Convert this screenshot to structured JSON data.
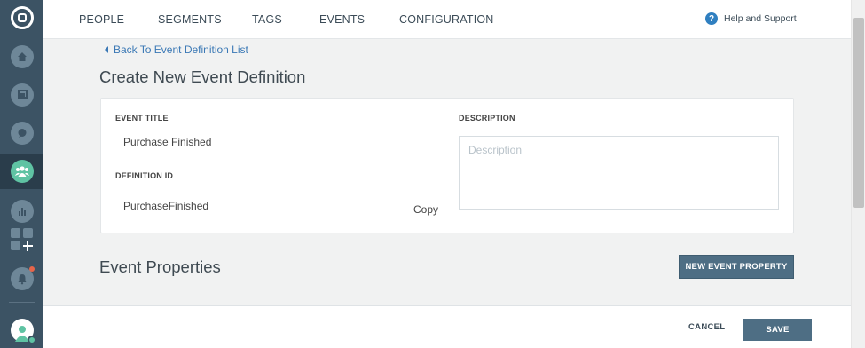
{
  "nav": {
    "items": [
      "PEOPLE",
      "SEGMENTS",
      "TAGS",
      "EVENTS",
      "CONFIGURATION"
    ],
    "help_label": "Help and Support",
    "help_glyph": "?"
  },
  "sidebar": {
    "icons": [
      "logo-icon",
      "home-icon",
      "campaigns-icon",
      "messages-icon",
      "people-icon",
      "analytics-icon",
      "add-app-icon",
      "notifications-icon",
      "user-avatar-icon"
    ],
    "active": "people-icon",
    "accent_color": "#5fc3a3"
  },
  "back_link": "Back To Event Definition List",
  "page_title": "Create New Event Definition",
  "form": {
    "event_title_label": "EVENT TITLE",
    "event_title_value": "Purchase Finished",
    "definition_id_label": "DEFINITION ID",
    "definition_id_value": "PurchaseFinished",
    "copy_label": "Copy",
    "description_label": "DESCRIPTION",
    "description_placeholder": "Description"
  },
  "properties": {
    "title": "Event Properties",
    "new_property_button": "NEW EVENT PROPERTY"
  },
  "footer": {
    "cancel_label": "CANCEL",
    "save_label": "SAVE"
  }
}
